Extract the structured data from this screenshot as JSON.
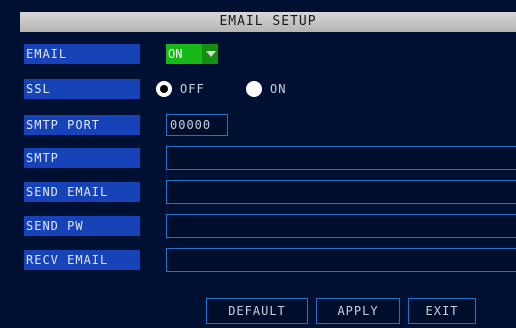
{
  "title": "EMAIL SETUP",
  "email": {
    "label": "EMAIL",
    "value": "ON"
  },
  "ssl": {
    "label": "SSL",
    "options": [
      "OFF",
      "ON"
    ],
    "selected": "OFF"
  },
  "smtp_port": {
    "label": "SMTP PORT",
    "value": "00000"
  },
  "smtp": {
    "label": "SMTP",
    "value": ""
  },
  "send_email": {
    "label": "SEND EMAIL",
    "value": ""
  },
  "send_pw": {
    "label": "SEND PW",
    "value": ""
  },
  "recv_email": {
    "label": "RECV EMAIL",
    "value": ""
  },
  "buttons": {
    "default": "DEFAULT",
    "apply": "APPLY",
    "exit": "EXIT"
  },
  "colors": {
    "background": "#001033",
    "label_bg": "#1644b8",
    "accent_on": "#18b818",
    "field_border": "#1d74c8"
  }
}
